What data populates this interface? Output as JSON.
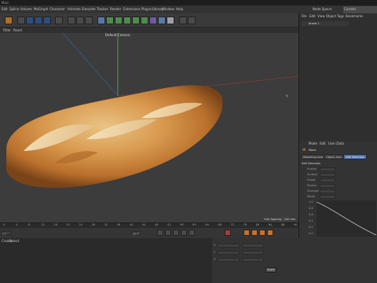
{
  "window": {
    "title": "Main"
  },
  "menubar": {
    "items": [
      "Edit",
      "Spline",
      "Volume",
      "MoGraph",
      "Character",
      "Animate",
      "Simulate",
      "Tracker",
      "Render",
      "Extensions",
      "Plugin/Library",
      "Window",
      "Help"
    ],
    "right_items": [
      "Node Space:",
      "Current (Standard/Physical)"
    ]
  },
  "viewport": {
    "menu": [
      "Filter",
      "Panel"
    ],
    "camera_label": "Default Camera",
    "axis_label": "Y",
    "grid_spacing": "Grid Spacing : 100 mm"
  },
  "object_manager": {
    "menu": [
      "File",
      "Edit",
      "View",
      "Object",
      "Tags",
      "Bookmarks"
    ],
    "item": "bread 1"
  },
  "attribute_manager": {
    "menu": [
      "Mode",
      "Edit",
      "User Data"
    ],
    "tool_name": "Move",
    "tabs": [
      "Modelling Axis",
      "Object Axis",
      "Soft Selection"
    ],
    "section_title": "Soft Selection",
    "fields": [
      "Enable",
      "Surface",
      "Falloff",
      "Radius",
      "Strength",
      "Width"
    ],
    "graph_ticks": [
      "1.0",
      "0.8",
      "0.6",
      "0.4",
      "0.2",
      "0.0"
    ]
  },
  "timeline": {
    "ticks": [
      "0",
      "4",
      "8",
      "12",
      "16",
      "20",
      "24",
      "28",
      "32",
      "36",
      "40",
      "44",
      "48",
      "52",
      "56",
      "60",
      "64",
      "68",
      "72",
      "76",
      "80",
      "84",
      "88",
      "90"
    ],
    "start": "0 F",
    "end": "90 F"
  },
  "coordinates": {
    "menu": [
      "Create",
      "Select"
    ],
    "rows": [
      "X",
      "Y",
      "Z"
    ],
    "apply": "Apply"
  },
  "colors": {
    "accent": "#4a6ea8",
    "viewport": "#3c3c3c"
  }
}
